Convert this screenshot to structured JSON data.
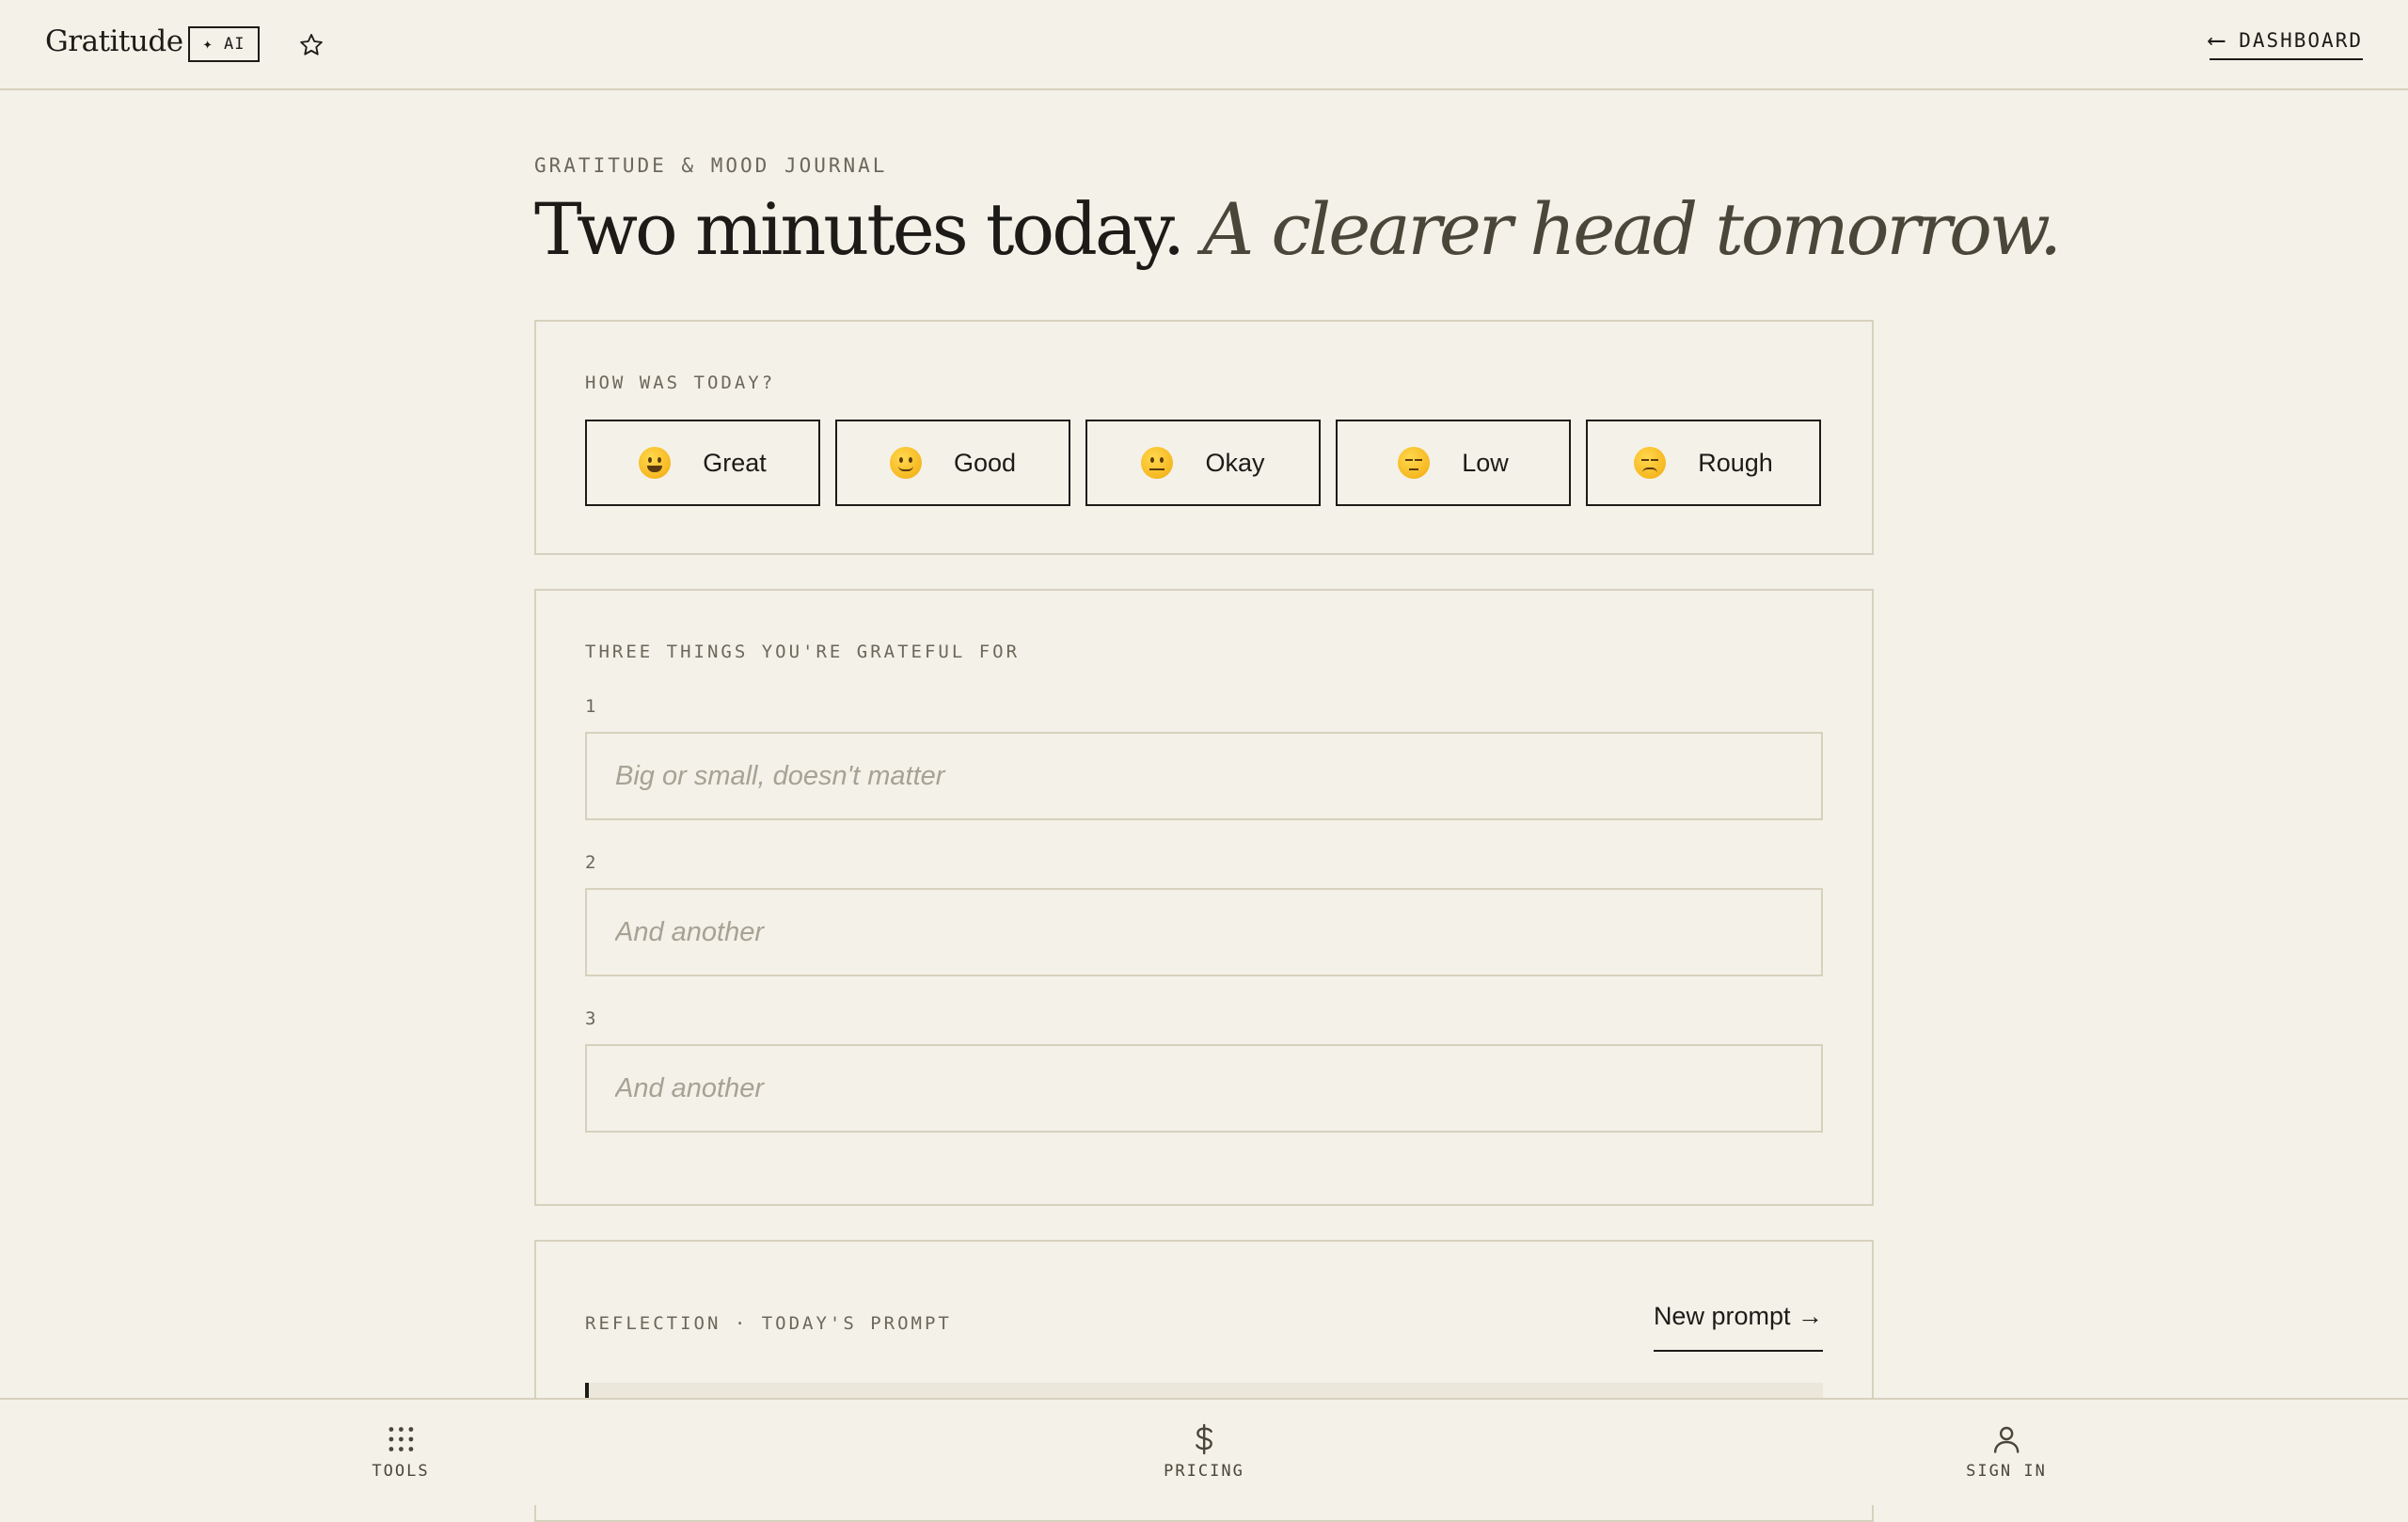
{
  "header": {
    "brand": "Gratitude",
    "ai_badge": "✦ AI",
    "back_arrow": "⟵",
    "back_label": "DASHBOARD"
  },
  "intro": {
    "eyebrow": "GRATITUDE & MOOD JOURNAL",
    "headline_strong": "Two minutes today.",
    "headline_em": "A clearer head tomorrow."
  },
  "mood": {
    "label": "HOW WAS TODAY?",
    "options": [
      {
        "label": "Great",
        "icon": "grinning-face-icon"
      },
      {
        "label": "Good",
        "icon": "slightly-smiling-face-icon"
      },
      {
        "label": "Okay",
        "icon": "neutral-face-icon"
      },
      {
        "label": "Low",
        "icon": "pensive-face-icon"
      },
      {
        "label": "Rough",
        "icon": "disappointed-face-icon"
      }
    ]
  },
  "gratitude": {
    "label": "THREE THINGS YOU'RE GRATEFUL FOR",
    "fields": [
      {
        "number": "1",
        "value": "",
        "placeholder": "Big or small, doesn't matter"
      },
      {
        "number": "2",
        "value": "",
        "placeholder": "And another"
      },
      {
        "number": "3",
        "value": "",
        "placeholder": "And another"
      }
    ]
  },
  "reflection": {
    "label": "REFLECTION · TODAY'S PROMPT",
    "new_prompt": "New prompt →"
  },
  "bottom_nav": [
    {
      "label": "TOOLS",
      "icon": "grid-icon"
    },
    {
      "label": "PRICING",
      "icon": "dollar-icon"
    },
    {
      "label": "SIGN IN",
      "icon": "user-icon"
    }
  ]
}
